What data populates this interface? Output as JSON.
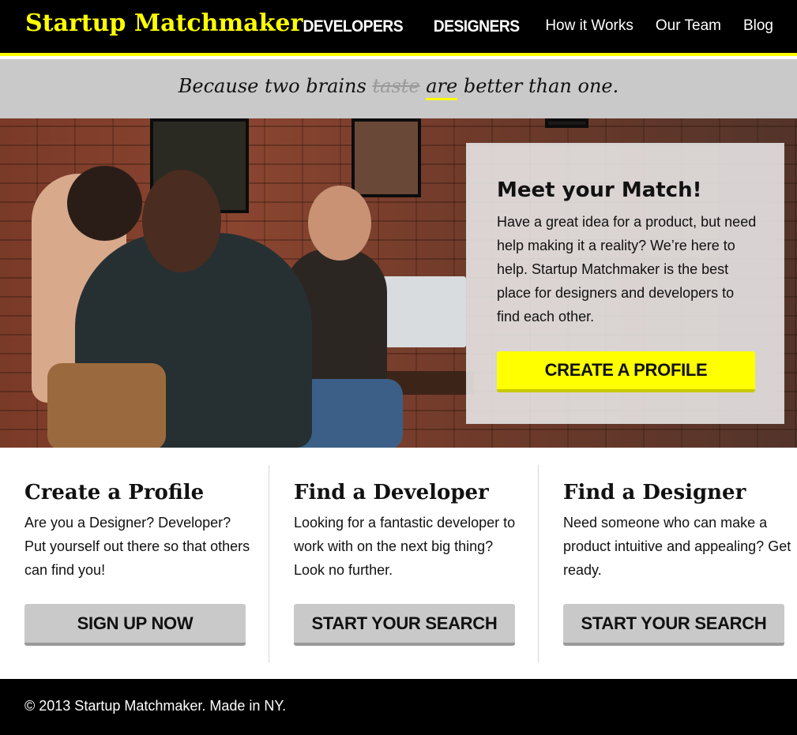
{
  "header": {
    "logo": "Startup Matchmaker",
    "nav": [
      {
        "label": "DEVELOPERS"
      },
      {
        "label": "DESIGNERS"
      },
      {
        "label": "How it Works"
      },
      {
        "label": "Our Team"
      },
      {
        "label": "Blog"
      }
    ]
  },
  "tagline": {
    "before": "Because two brains ",
    "struck": "taste",
    "accent": "are",
    "after": " better than one."
  },
  "hero": {
    "title": "Meet your Match!",
    "body": "Have a great idea for a product, but need help making it a reality? We’re here to help. Startup Matchmaker is the best place for designers and developers to find each other.",
    "cta": "CREATE A PROFILE"
  },
  "columns": [
    {
      "title": "Create a Profile",
      "body": "Are you a Designer? Developer? Put yourself out there so that others can find you!",
      "button": "SIGN UP NOW"
    },
    {
      "title": "Find a Developer",
      "body": "Looking for a fantastic developer to work with on the next big thing? Look no further.",
      "button": "START YOUR SEARCH"
    },
    {
      "title": "Find a Designer",
      "body": "Need someone who can make a product intuitive and appealing? Get ready.",
      "button": "START YOUR SEARCH"
    }
  ],
  "footer": {
    "text": "© 2013 Startup Matchmaker. Made in NY."
  },
  "colors": {
    "accent": "#ffff00",
    "header_bg": "#000000",
    "tagline_bg": "#c9c9c9",
    "button_gray": "#c9c9c9"
  }
}
